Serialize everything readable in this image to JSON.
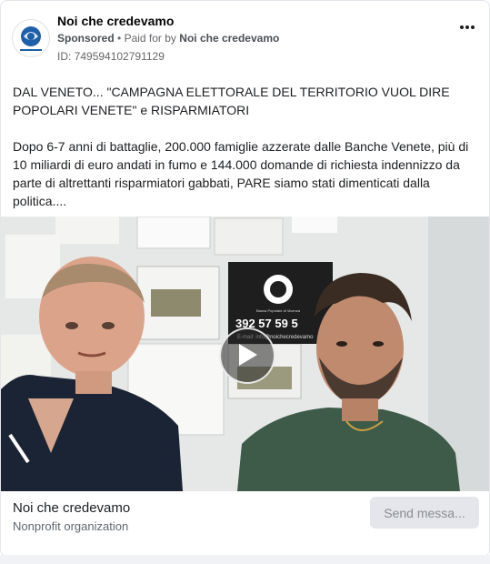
{
  "post": {
    "page_name": "Noi che credevamo",
    "sponsored_label": "Sponsored",
    "separator": "•",
    "paid_for_prefix": "Paid for by",
    "paid_for_name": "Noi che credevamo",
    "id_line": "ID: 749594102791129",
    "more_icon": "more-horizontal-icon",
    "body_paragraphs": [
      "DAL VENETO... \"CAMPAGNA ELETTORALE DEL TERRITORIO VUOL DIRE POPOLARI VENETE\" e RISPARMIATORI",
      "Dopo 6-7 anni di battaglie, 200.000 famiglie azzerate dalle Banche Venete, più di 10 miliardi di euro andati in fumo e 144.000 domande di richiesta indennizzo da parte di altrettanti risparmiatori gabbati, PARE siamo stati dimenticati dalla politica...."
    ]
  },
  "video": {
    "poster_text": {
      "bank_label": "Banca Popolare di Vicenza",
      "phone": "392 57 59 5",
      "email": "E-mail: info@noichecredevamo"
    },
    "play_icon": "play-icon"
  },
  "footer": {
    "name": "Noi che credevamo",
    "category": "Nonprofit organization",
    "cta_label": "Send messa..."
  },
  "colors": {
    "text_primary": "#1c1e21",
    "text_secondary": "#65676b",
    "cta_bg": "#e4e6eb",
    "cta_text": "#8a8d91",
    "logo_blue": "#1d5fa8"
  }
}
